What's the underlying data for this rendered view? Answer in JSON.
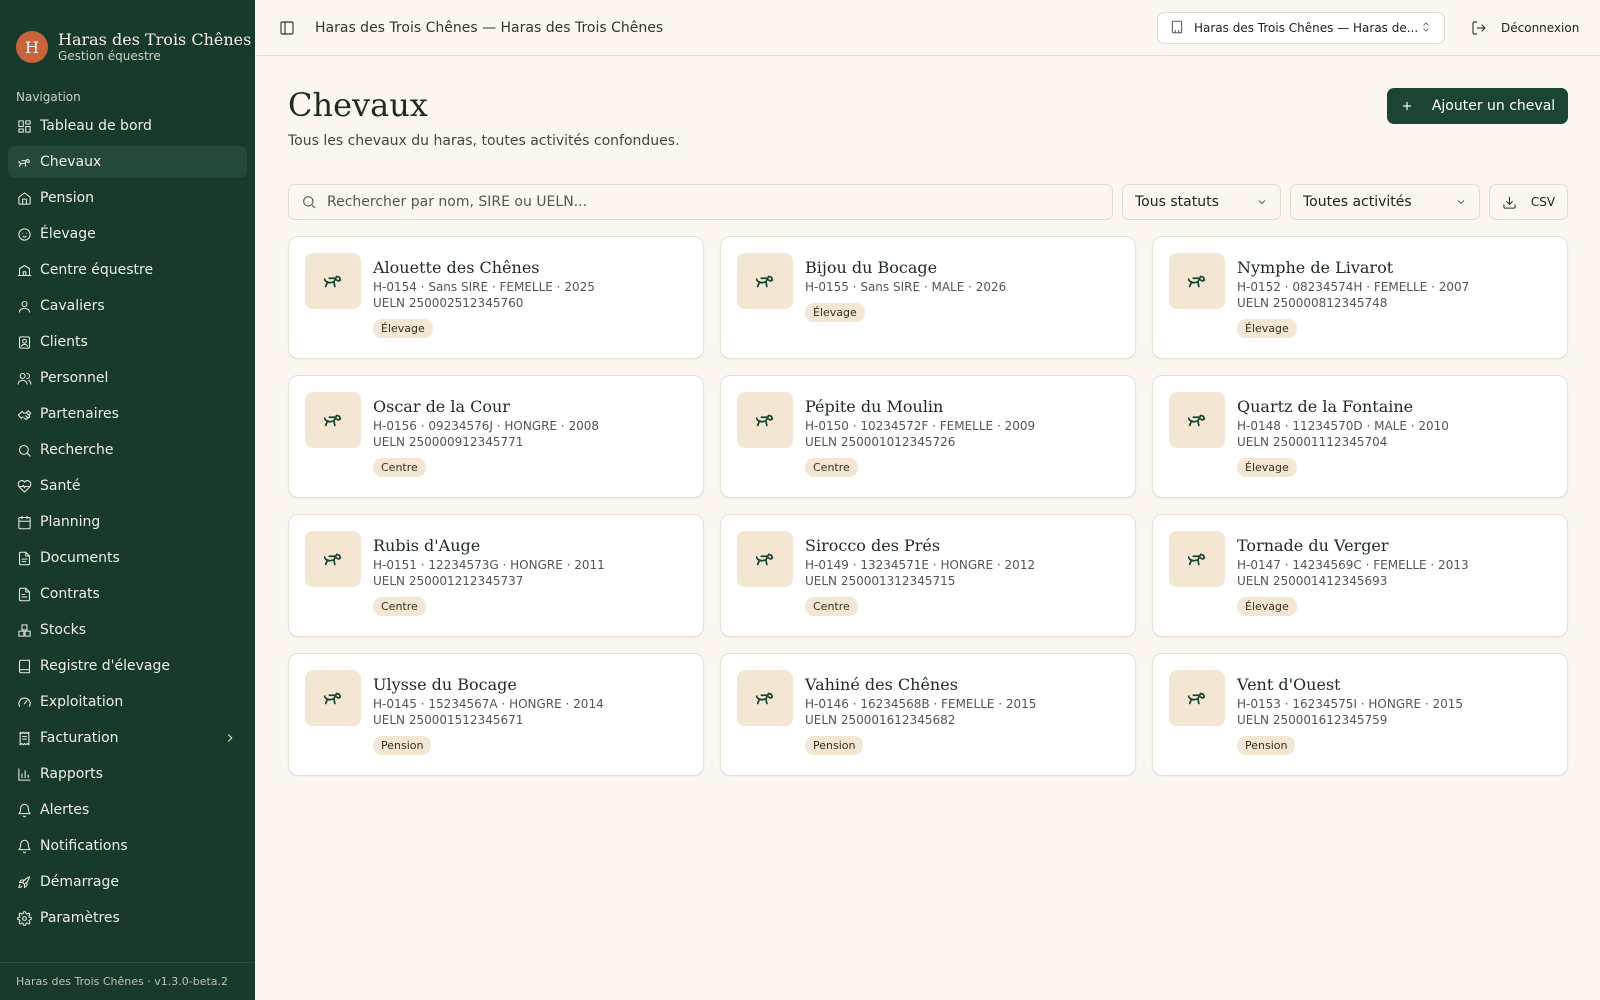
{
  "brand": {
    "initial": "H",
    "name": "Haras des Trois Chênes",
    "subtitle": "Gestion équestre"
  },
  "sidebar": {
    "heading": "Navigation",
    "items": [
      {
        "label": "Tableau de bord",
        "icon": "dashboard-icon"
      },
      {
        "label": "Chevaux",
        "icon": "horse-icon",
        "active": true
      },
      {
        "label": "Pension",
        "icon": "home-icon"
      },
      {
        "label": "Élevage",
        "icon": "baby-icon"
      },
      {
        "label": "Centre équestre",
        "icon": "school-icon"
      },
      {
        "label": "Cavaliers",
        "icon": "user-icon"
      },
      {
        "label": "Clients",
        "icon": "contact-icon"
      },
      {
        "label": "Personnel",
        "icon": "users-icon"
      },
      {
        "label": "Partenaires",
        "icon": "handshake-icon"
      },
      {
        "label": "Recherche",
        "icon": "search-icon"
      },
      {
        "label": "Santé",
        "icon": "heart-pulse-icon"
      },
      {
        "label": "Planning",
        "icon": "calendar-icon"
      },
      {
        "label": "Documents",
        "icon": "document-icon"
      },
      {
        "label": "Contrats",
        "icon": "contract-icon"
      },
      {
        "label": "Stocks",
        "icon": "boxes-icon"
      },
      {
        "label": "Registre d'élevage",
        "icon": "book-icon"
      },
      {
        "label": "Exploitation",
        "icon": "gauge-icon"
      },
      {
        "label": "Facturation",
        "icon": "receipt-icon",
        "expandable": true
      },
      {
        "label": "Rapports",
        "icon": "bar-chart-icon"
      },
      {
        "label": "Alertes",
        "icon": "bell-icon"
      },
      {
        "label": "Notifications",
        "icon": "bell-ring-icon"
      },
      {
        "label": "Démarrage",
        "icon": "rocket-icon"
      },
      {
        "label": "Paramètres",
        "icon": "gear-icon"
      }
    ],
    "footer": "Haras des Trois Chênes · v1.3.0-beta.2"
  },
  "header": {
    "title": "Haras des Trois Chênes — Haras des Trois Chênes",
    "org_select": "Haras des Trois Chênes — Haras de...",
    "logout_label": "Déconnexion"
  },
  "main": {
    "title": "Chevaux",
    "subtitle": "Tous les chevaux du haras, toutes activités confondues.",
    "add_label": "Ajouter un cheval",
    "search_placeholder": "Rechercher par nom, SIRE ou UELN...",
    "status_filter": "Tous statuts",
    "activity_filter": "Toutes activités",
    "csv_label": "CSV"
  },
  "horses": [
    {
      "name": "Alouette des Chênes",
      "meta": "H-0154 · Sans SIRE · FEMELLE · 2025",
      "ueln": "UELN 250002512345760",
      "activity": "Élevage"
    },
    {
      "name": "Bijou du Bocage",
      "meta": "H-0155 · Sans SIRE · MALE · 2026",
      "ueln": "",
      "activity": "Élevage"
    },
    {
      "name": "Nymphe de Livarot",
      "meta": "H-0152 · 08234574H · FEMELLE · 2007",
      "ueln": "UELN 250000812345748",
      "activity": "Élevage"
    },
    {
      "name": "Oscar de la Cour",
      "meta": "H-0156 · 09234576J · HONGRE · 2008",
      "ueln": "UELN 250000912345771",
      "activity": "Centre"
    },
    {
      "name": "Pépite du Moulin",
      "meta": "H-0150 · 10234572F · FEMELLE · 2009",
      "ueln": "UELN 250001012345726",
      "activity": "Centre"
    },
    {
      "name": "Quartz de la Fontaine",
      "meta": "H-0148 · 11234570D · MALE · 2010",
      "ueln": "UELN 250001112345704",
      "activity": "Élevage"
    },
    {
      "name": "Rubis d'Auge",
      "meta": "H-0151 · 12234573G · HONGRE · 2011",
      "ueln": "UELN 250001212345737",
      "activity": "Centre"
    },
    {
      "name": "Sirocco des Prés",
      "meta": "H-0149 · 13234571E · HONGRE · 2012",
      "ueln": "UELN 250001312345715",
      "activity": "Centre"
    },
    {
      "name": "Tornade du Verger",
      "meta": "H-0147 · 14234569C · FEMELLE · 2013",
      "ueln": "UELN 250001412345693",
      "activity": "Élevage"
    },
    {
      "name": "Ulysse du Bocage",
      "meta": "H-0145 · 15234567A · HONGRE · 2014",
      "ueln": "UELN 250001512345671",
      "activity": "Pension"
    },
    {
      "name": "Vahiné des Chênes",
      "meta": "H-0146 · 16234568B · FEMELLE · 2015",
      "ueln": "UELN 250001612345682",
      "activity": "Pension"
    },
    {
      "name": "Vent d'Ouest",
      "meta": "H-0153 · 16234575I · HONGRE · 2015",
      "ueln": "UELN 250001612345759",
      "activity": "Pension"
    }
  ],
  "colors": {
    "sidebar": "#183a2a",
    "accent": "#1b4532",
    "brand_logo": "#c8643b",
    "badge": "#f3e7d4",
    "background": "#fbf7f0"
  }
}
